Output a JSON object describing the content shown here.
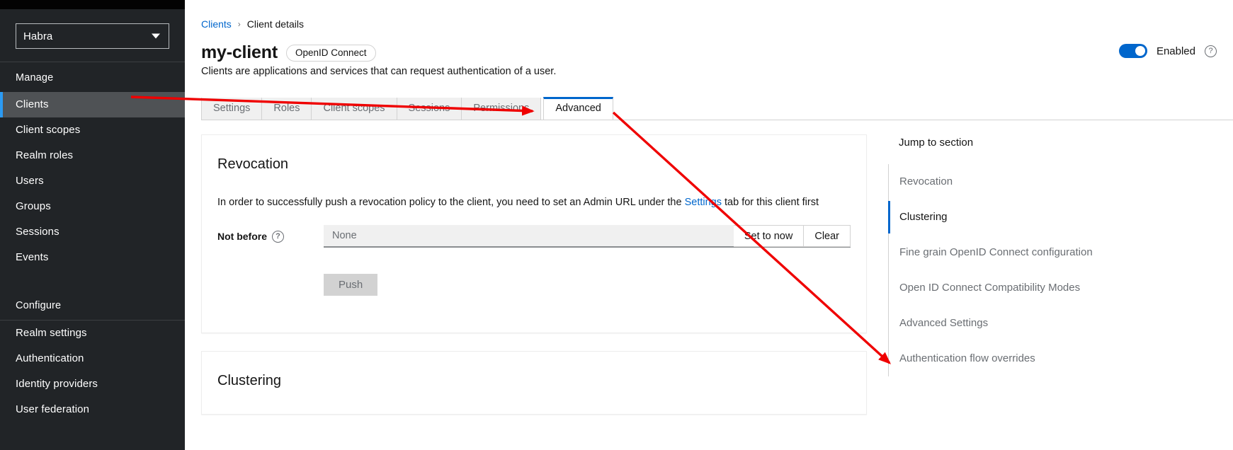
{
  "sidebar": {
    "realm_selector": {
      "value": "Habra",
      "icon": "chevron-down-icon"
    },
    "manage_label": "Manage",
    "manage_items": [
      {
        "label": "Clients",
        "active": true
      },
      {
        "label": "Client scopes",
        "active": false
      },
      {
        "label": "Realm roles",
        "active": false
      },
      {
        "label": "Users",
        "active": false
      },
      {
        "label": "Groups",
        "active": false
      },
      {
        "label": "Sessions",
        "active": false
      },
      {
        "label": "Events",
        "active": false
      }
    ],
    "configure_label": "Configure",
    "configure_items": [
      {
        "label": "Realm settings"
      },
      {
        "label": "Authentication"
      },
      {
        "label": "Identity providers"
      },
      {
        "label": "User federation"
      }
    ]
  },
  "breadcrumb": {
    "root": "Clients",
    "separator": "›",
    "current": "Client details"
  },
  "header": {
    "title": "my-client",
    "badge": "OpenID Connect",
    "subtitle": "Clients are applications and services that can request authentication of a user.",
    "enabled_label": "Enabled",
    "enabled_on": true,
    "help_icon": "help-circle-icon"
  },
  "tabs": [
    {
      "label": "Settings",
      "active": false
    },
    {
      "label": "Roles",
      "active": false
    },
    {
      "label": "Client scopes",
      "active": false
    },
    {
      "label": "Sessions",
      "active": false
    },
    {
      "label": "Permissions",
      "active": false
    },
    {
      "label": "Advanced",
      "active": true
    }
  ],
  "revocation": {
    "title": "Revocation",
    "description_before": "In order to successfully push a revocation policy to the client, you need to set an Admin URL under the ",
    "description_link": "Settings",
    "description_after": " tab for this client first",
    "not_before_label": "Not before",
    "not_before_help_icon": "help-circle-icon",
    "not_before_value": "None",
    "set_to_now_label": "Set to now",
    "clear_label": "Clear",
    "push_label": "Push"
  },
  "clustering": {
    "title": "Clustering"
  },
  "jump_to_section": {
    "title": "Jump to section",
    "items": [
      {
        "label": "Revocation",
        "active": false
      },
      {
        "label": "Clustering",
        "active": true
      },
      {
        "label": "Fine grain OpenID Connect configuration",
        "active": false
      },
      {
        "label": "Open ID Connect Compatibility Modes",
        "active": false
      },
      {
        "label": "Advanced Settings",
        "active": false
      },
      {
        "label": "Authentication flow overrides",
        "active": false
      }
    ]
  },
  "colors": {
    "accent_blue": "#06c",
    "sidebar_bg": "#212427",
    "annotation_red": "#ef0000"
  }
}
